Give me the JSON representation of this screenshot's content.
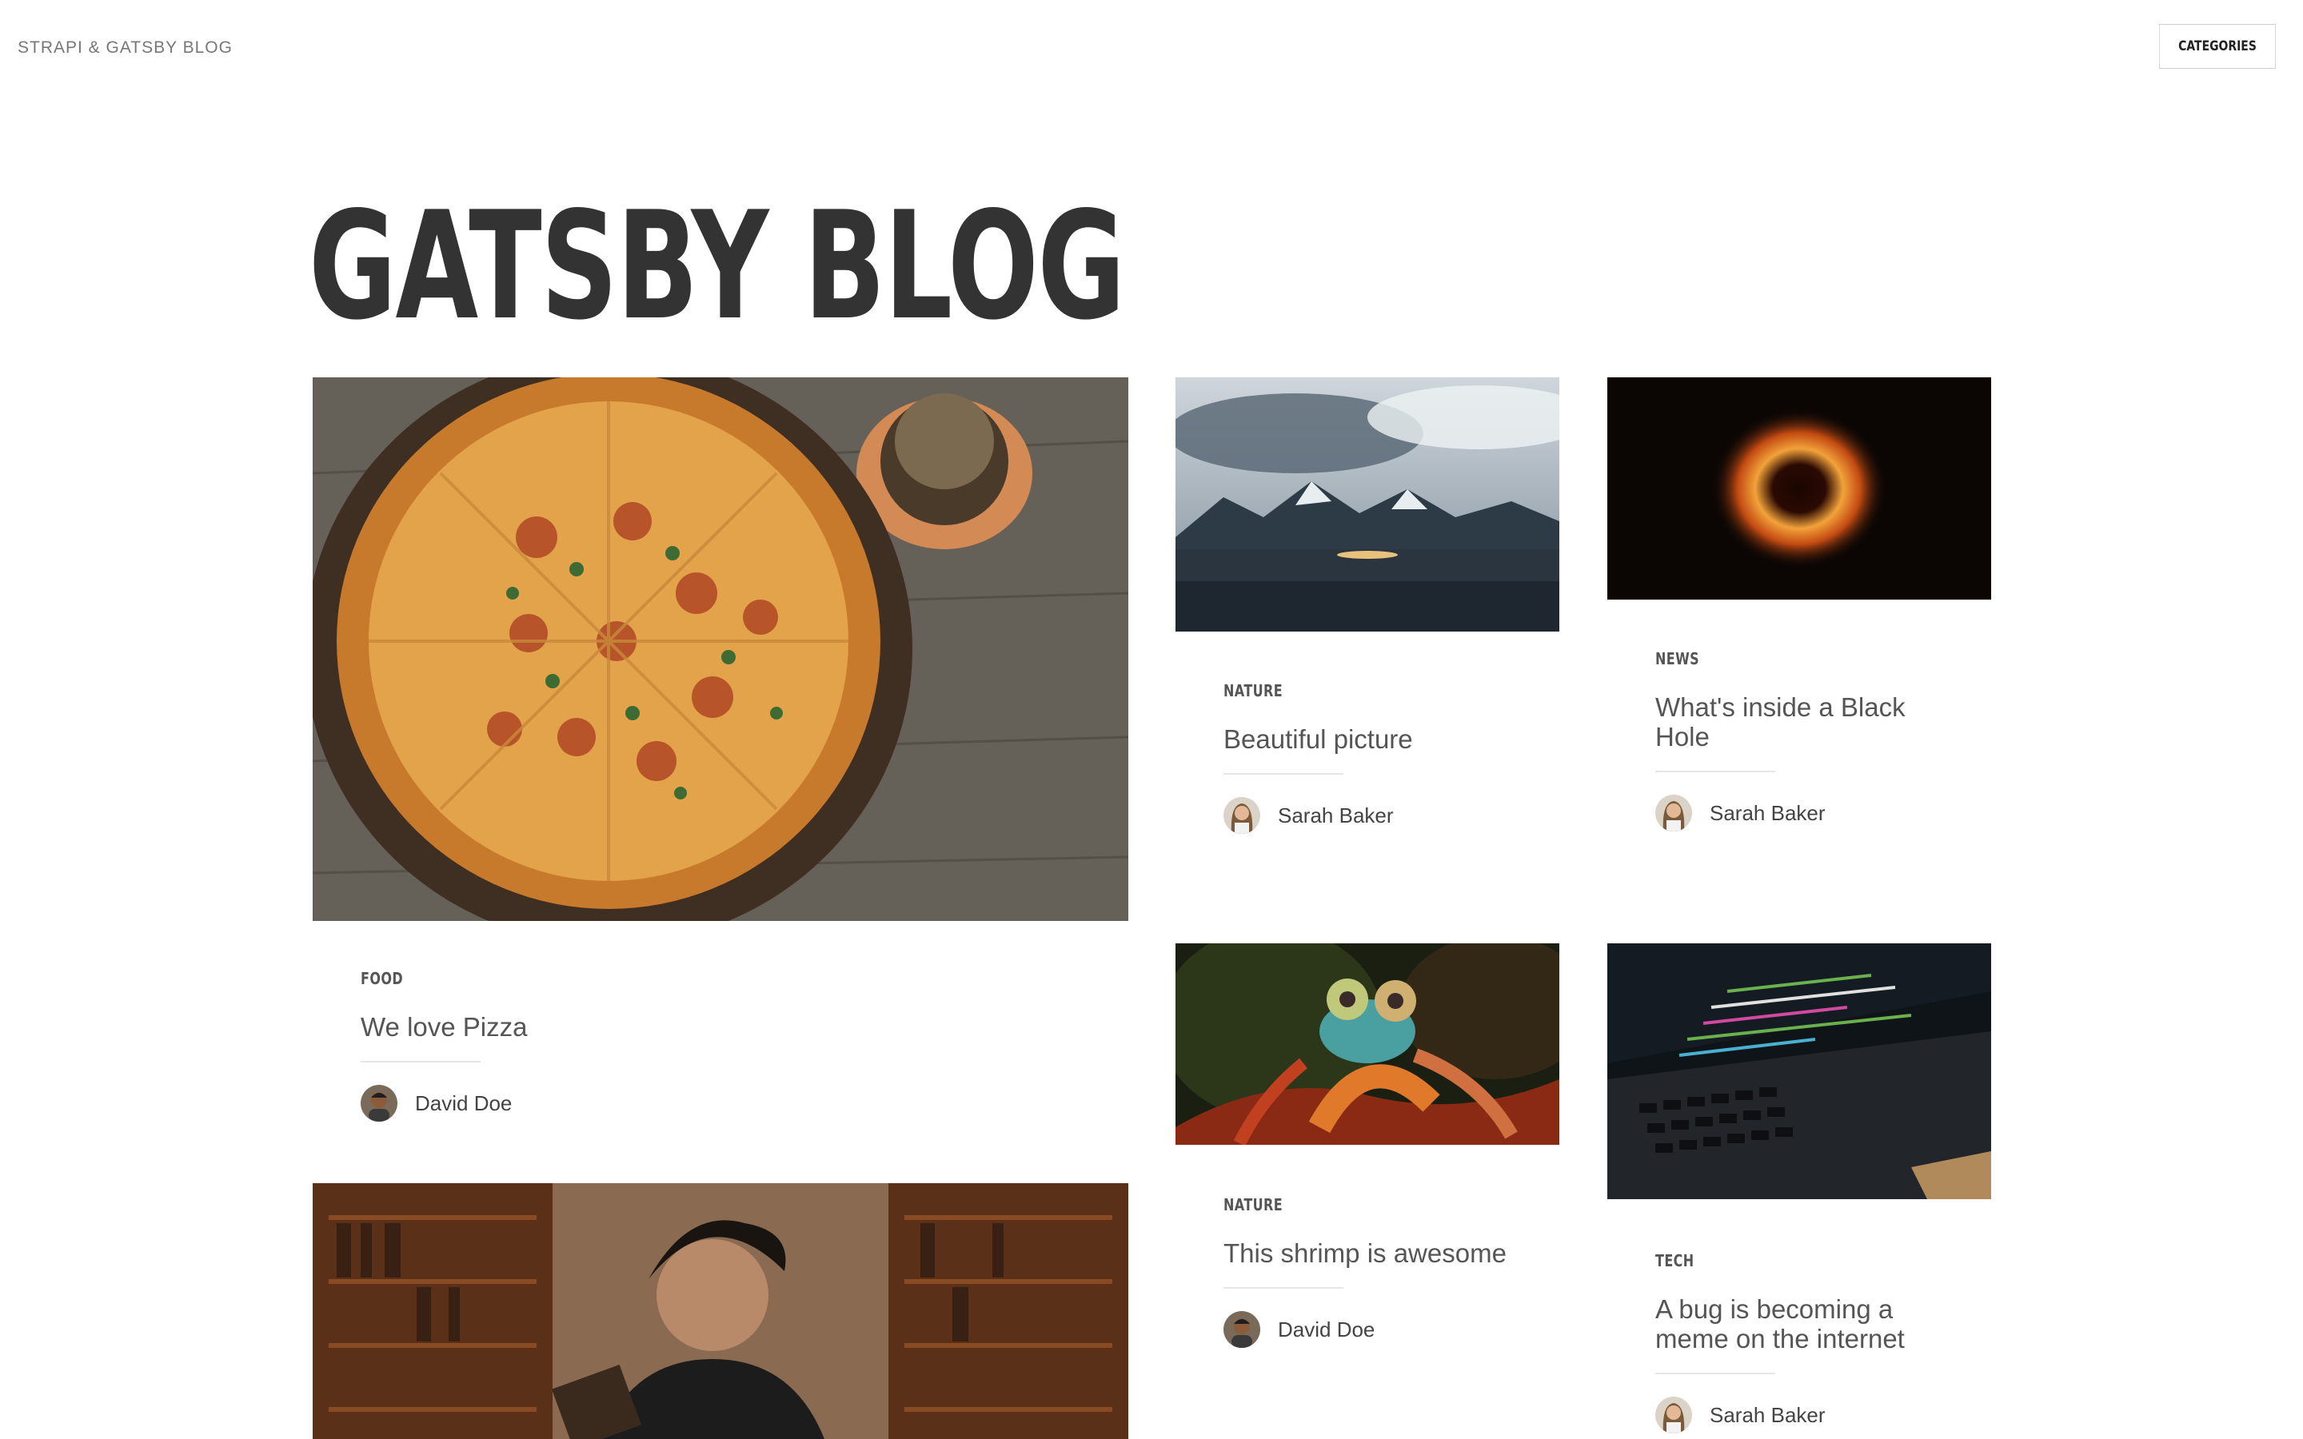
{
  "header": {
    "brand": "STRAPI & GATSBY BLOG",
    "categories_button": "CATEGORIES"
  },
  "main": {
    "title": "GATSBY BLOG"
  },
  "articles": [
    {
      "category": "FOOD",
      "title": "We love Pizza",
      "author": "David Doe",
      "image": "pizza-image"
    },
    {
      "category": "NATURE",
      "title": "Beautiful picture",
      "author": "Sarah Baker",
      "image": "mountains-image"
    },
    {
      "category": "NEWS",
      "title": "What's inside a Black Hole",
      "author": "Sarah Baker",
      "image": "black-hole-image"
    },
    {
      "category": "NATURE",
      "title": "This shrimp is awesome",
      "author": "David Doe",
      "image": "shrimp-image"
    },
    {
      "category": "TECH",
      "title": "A bug is becoming a meme on the internet",
      "author": "Sarah Baker",
      "image": "laptop-code-image"
    },
    {
      "image": "library-reader-image"
    }
  ],
  "colors": {
    "background": "#ffffff",
    "title": "#333333",
    "text": "#555555",
    "rule": "#e6e6e6"
  }
}
